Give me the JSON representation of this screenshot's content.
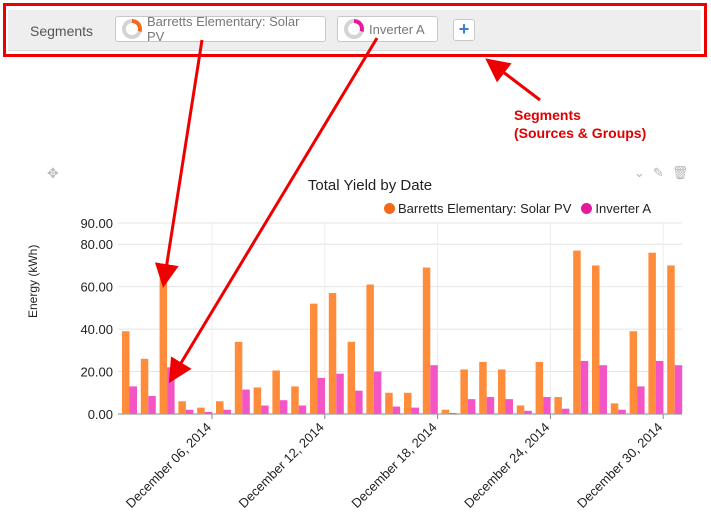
{
  "segments_bar": {
    "label": "Segments",
    "chips": [
      {
        "label": "Barretts Elementary: Solar PV",
        "color": "#f26a1b"
      },
      {
        "label": "Inverter A",
        "color": "#e8189b"
      }
    ],
    "add_symbol": "+"
  },
  "annotation": {
    "line1": "Segments",
    "line2": "(Sources & Groups)",
    "color": "#e00000"
  },
  "widget": {
    "title": "Total Yield by Date",
    "move_icon": "move-icon",
    "action_icons": [
      "chevron-down-icon",
      "edit-icon",
      "trash-icon"
    ]
  },
  "chart_data": {
    "type": "bar",
    "title": "Total Yield by Date",
    "ylabel": "Energy (kWh)",
    "xlabel": "",
    "ylim": [
      0,
      90
    ],
    "y_ticks": [
      "0.00",
      "20.00",
      "40.00",
      "60.00",
      "80.00",
      "90.00"
    ],
    "x_tick_labels": [
      "December 06, 2014",
      "December 12, 2014",
      "December 18, 2014",
      "December 24, 2014",
      "December 30, 2014"
    ],
    "legend_position": "top-right",
    "series": [
      {
        "name": "Barretts Elementary: Solar PV",
        "color": "#ff8c3a",
        "values": [
          39,
          26,
          65,
          6,
          3,
          6,
          34,
          12.5,
          20.5,
          13,
          52,
          57,
          34,
          61,
          10,
          10,
          69,
          2,
          21,
          24.5,
          21,
          4,
          24.5,
          8,
          77,
          70,
          5,
          39,
          76,
          70
        ]
      },
      {
        "name": "Inverter A",
        "color": "#f455c6",
        "values": [
          13,
          8.5,
          22,
          2,
          1,
          2,
          11.5,
          4,
          6.5,
          4,
          17,
          19,
          11,
          20,
          3.5,
          3,
          23,
          0.5,
          7,
          8,
          7,
          1.5,
          8,
          2.5,
          25,
          23,
          2,
          13,
          25,
          23
        ]
      }
    ]
  }
}
